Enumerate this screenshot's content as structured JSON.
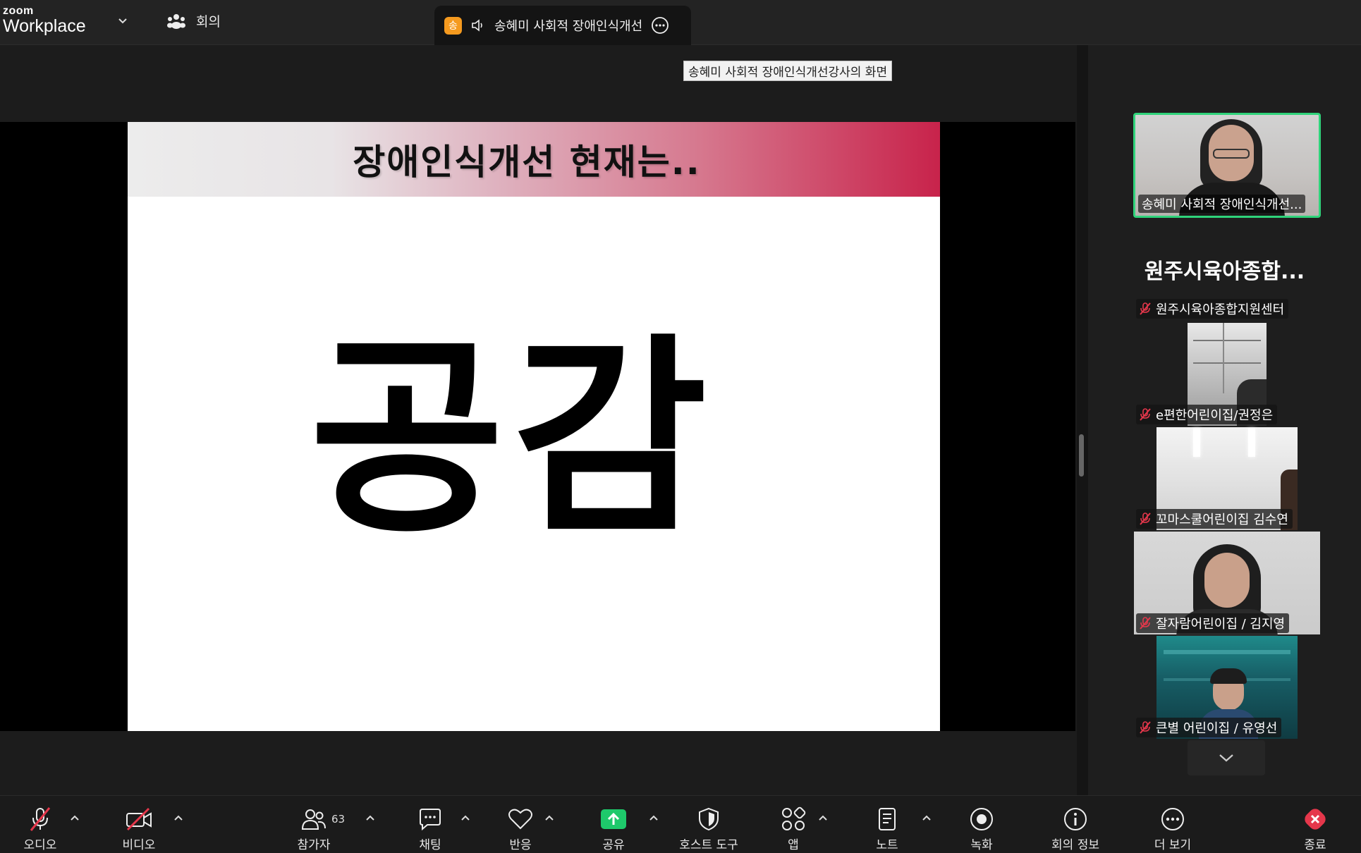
{
  "app": {
    "logo_line1": "zoom",
    "logo_line2": "Workplace",
    "meeting_nav_label": "회의"
  },
  "tab": {
    "badge": "송",
    "title": "송혜미 사회적 장애인식개선"
  },
  "screen_share_label": "송혜미 사회적 장애인식개선강사의 화면",
  "slide": {
    "header": "장애인식개선 현재는..",
    "main_word": "공감"
  },
  "speaker": {
    "name": "송혜미 사회적 장애인식개선..."
  },
  "group_title": "원주시육아종합...",
  "participants": [
    {
      "name": "원주시육아종합지원센터",
      "muted": true
    },
    {
      "name": "e편한어린이집/권정은",
      "muted": true
    },
    {
      "name": "꼬마스쿨어린이집 김수연",
      "muted": true
    },
    {
      "name": "잘자람어린이집 / 김지영",
      "muted": true
    },
    {
      "name": "큰별 어린이집 / 유영선",
      "muted": true
    }
  ],
  "toolbar": {
    "audio": "오디오",
    "video": "비디오",
    "participants": "참가자",
    "participants_count": "63",
    "chat": "채팅",
    "reactions": "반응",
    "share": "공유",
    "host_tools": "호스트 도구",
    "apps": "앱",
    "notes": "노트",
    "record": "녹화",
    "meeting_info": "회의 정보",
    "more": "더 보기",
    "end": "종료"
  },
  "colors": {
    "active_speaker_border": "#2fd37a",
    "share_green": "#1ec96b",
    "end_red": "#e5374b",
    "muted_red": "#e5374b",
    "tab_badge": "#f59a1f"
  }
}
